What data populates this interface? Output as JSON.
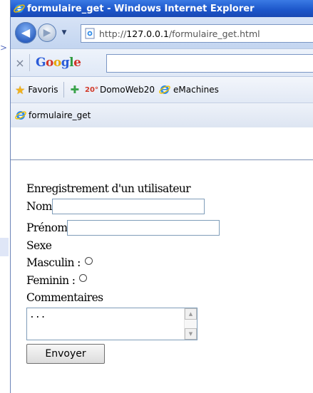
{
  "window": {
    "title": "formulaire_get - Windows Internet Explorer"
  },
  "address_bar": {
    "url_prefix": "http://",
    "url_host": "127.0.0.1",
    "url_path": "/formulaire_get.html"
  },
  "google_toolbar": {
    "close": "×",
    "logo_parts": [
      "G",
      "o",
      "o",
      "g",
      "l",
      "e"
    ],
    "search_value": ""
  },
  "favorites_bar": {
    "favorites_label": "Favoris",
    "temperature_badge": "20°",
    "item_domoweb": "DomoWeb20",
    "item_emachines": "eMachines"
  },
  "tab": {
    "label": "formulaire_get"
  },
  "form": {
    "heading": "Enregistrement d'un utilisateur",
    "nom_label": "Nom",
    "nom_value": "",
    "prenom_label": "Prénom",
    "prenom_value": "",
    "sexe_label": "Sexe",
    "masculin_label": "Masculin :",
    "feminin_label": "Feminin :",
    "commentaires_label": "Commentaires",
    "commentaires_value": "...",
    "submit_label": "Envoyer"
  },
  "colors": {
    "titlebar": "#1c55c9",
    "chrome": "#c3d5f0"
  }
}
